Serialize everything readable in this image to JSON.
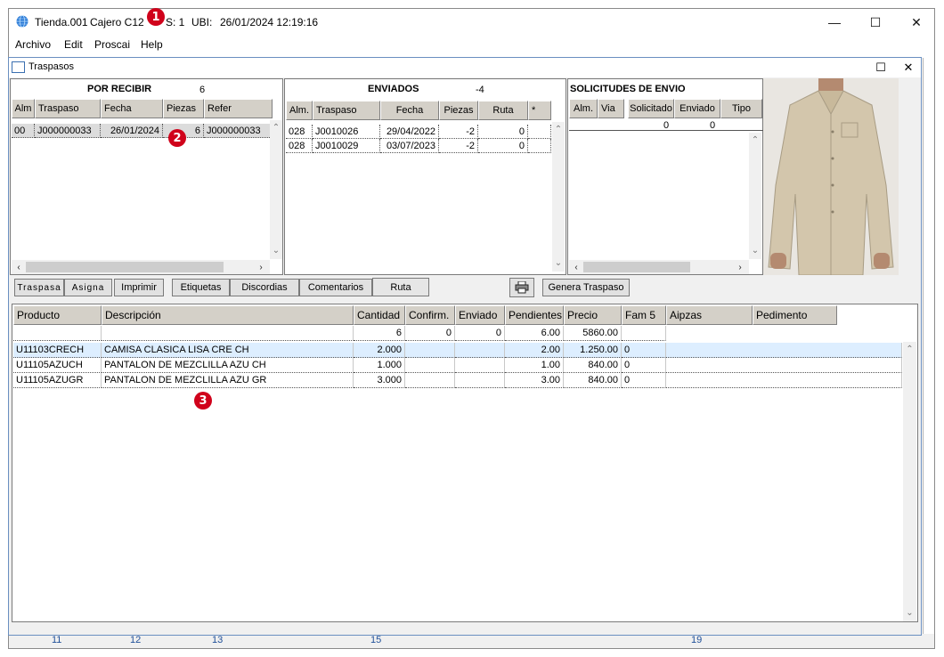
{
  "window": {
    "title_store": "Tienda.001",
    "title_cashier": "Cajero C12",
    "title_s_label": "S: 1",
    "title_ubi_label": "UBI:",
    "title_datetime": "26/01/2024 12:19:16",
    "minimize": "—",
    "maximize": "☐",
    "close": "✕"
  },
  "menu": {
    "items": [
      "Archivo",
      "Edit",
      "Proscai",
      "Help"
    ]
  },
  "background_numbers": [
    "11",
    "12",
    "13",
    "15",
    "19"
  ],
  "child": {
    "title": "Traspasos",
    "maximize": "☐",
    "close": "✕"
  },
  "por_recibir": {
    "title": "POR RECIBIR",
    "count": "6",
    "headers": [
      "Alm",
      "Traspaso",
      "Fecha",
      "Piezas",
      "Refer"
    ],
    "rows": [
      [
        "00",
        "J000000033",
        "26/01/2024",
        "6",
        "J000000033"
      ]
    ]
  },
  "enviados": {
    "title": "ENVIADOS",
    "count": "-4",
    "headers": [
      "Alm.",
      "Traspaso",
      "Fecha",
      "Piezas",
      "Ruta",
      "*"
    ],
    "rows": [
      [
        "028",
        "J0010026",
        "29/04/2022",
        "-2",
        "0",
        ""
      ],
      [
        "028",
        "J0010029",
        "03/07/2023",
        "-2",
        "0",
        ""
      ]
    ]
  },
  "solicitudes": {
    "title": "SOLICITUDES DE ENVIO",
    "headers": [
      "Alm.",
      "Via",
      "Solicitado",
      "Enviado",
      "Tipo"
    ],
    "totals": [
      "0",
      "0"
    ]
  },
  "toolbar": {
    "traspasa": "Traspasa",
    "asigna": "Asigna",
    "imprimir": "Imprimir",
    "etiquetas": "Etiquetas",
    "discordias": "Discordias",
    "comentarios": "Comentarios",
    "ruta": "Ruta",
    "print_icon": "printer-icon",
    "genera_traspaso": "Genera Traspaso"
  },
  "products": {
    "headers": [
      "Producto",
      "Descripción",
      "Cantidad",
      "Confirm.",
      "Enviado",
      "Pendientes",
      "Precio",
      "Fam 5",
      "Aipzas",
      "Pedimento"
    ],
    "totals": [
      "6",
      "0",
      "0",
      "6.00",
      "5860.00"
    ],
    "rows": [
      [
        "U11103CRECH",
        "CAMISA CLASICA LISA CRE CH",
        "2.000",
        "",
        "",
        "2.00",
        "1.250.00",
        "0"
      ],
      [
        "U11105AZUCH",
        "PANTALON DE MEZCLILLA AZU CH",
        "1.000",
        "",
        "",
        "1.00",
        "840.00",
        "0"
      ],
      [
        "U11105AZUGR",
        "PANTALON DE MEZCLILLA AZU GR",
        "3.000",
        "",
        "",
        "3.00",
        "840.00",
        "0"
      ]
    ]
  },
  "annotations": [
    "1",
    "2",
    "3"
  ],
  "colors": {
    "badge": "#d0021b",
    "selected_row": "#ddeeff"
  }
}
